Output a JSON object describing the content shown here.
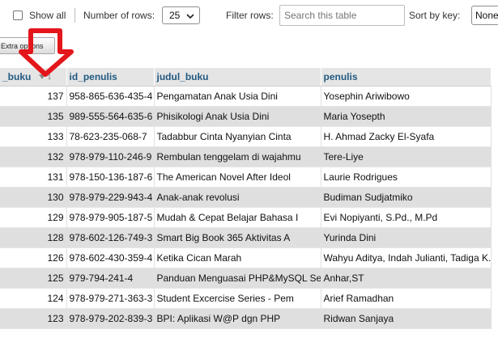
{
  "toolbar": {
    "show_all_label": "Show all",
    "rows_label": "Number of rows:",
    "rows_value": "25",
    "filter_label": "Filter rows:",
    "filter_placeholder": "Search this table",
    "sort_label": "Sort by key:",
    "sort_value": "None"
  },
  "extra_options_label": "Extra options",
  "columns": {
    "c1": "_buku",
    "c1_sort_index": "1",
    "c2": "id_penulis",
    "c3": "judul_buku",
    "c4": "penulis"
  },
  "rows": [
    {
      "id": "137",
      "isbn": "958-865-636-435-4",
      "judul": "Pengamatan Anak Usia Dini",
      "penulis": "Yosephin Ariwibowo"
    },
    {
      "id": "135",
      "isbn": "989-555-564-635-6",
      "judul": "Phisikologi Anak Usia Dini",
      "penulis": "Maria Yosepth"
    },
    {
      "id": "133",
      "isbn": "78-623-235-068-7",
      "judul": "Tadabbur Cinta Nyanyian Cinta",
      "penulis": "H. Ahmad Zacky El-Syafa"
    },
    {
      "id": "132",
      "isbn": "978-979-110-246-9",
      "judul": "Rembulan tenggelam di wajahmu",
      "penulis": "Tere-Liye"
    },
    {
      "id": "131",
      "isbn": "978-150-136-187-6",
      "judul": "The American Novel After Ideol",
      "penulis": "Laurie Rodrigues"
    },
    {
      "id": "130",
      "isbn": "978-979-229-943-4",
      "judul": "Anak-anak revolusi",
      "penulis": "Budiman Sudjatmiko"
    },
    {
      "id": "129",
      "isbn": "978-979-905-187-5",
      "judul": "Mudah & Cepat Belajar Bahasa I",
      "penulis": "Evi Nopiyanti, S.Pd., M.Pd"
    },
    {
      "id": "128",
      "isbn": "978-602-126-749-3",
      "judul": "Smart Big Book 365 Aktivitas A",
      "penulis": "Yurinda Dini"
    },
    {
      "id": "126",
      "isbn": "978-602-430-359-4",
      "judul": "Ketika Cican Marah",
      "penulis": "Wahyu Aditya, Indah Julianti, Tadiga K."
    },
    {
      "id": "125",
      "isbn": "979-794-241-4",
      "judul": "Panduan Menguasai PHP&MySQL Se",
      "penulis": "Anhar,ST"
    },
    {
      "id": "124",
      "isbn": "978-979-271-363-3",
      "judul": "Student Excercise Series - Pem",
      "penulis": "Arief Ramadhan"
    },
    {
      "id": "123",
      "isbn": "978-979-202-839-3",
      "judul": "BPI: Aplikasi W@P dgn PHP",
      "penulis": "Ridwan Sanjaya"
    }
  ],
  "colors": {
    "header_text": "#235a81",
    "arrow": "#e3161b"
  },
  "icons": [
    "checkbox-icon",
    "dropdown-caret-icon",
    "sort-arrow-icon",
    "red-arrow-annotation"
  ]
}
